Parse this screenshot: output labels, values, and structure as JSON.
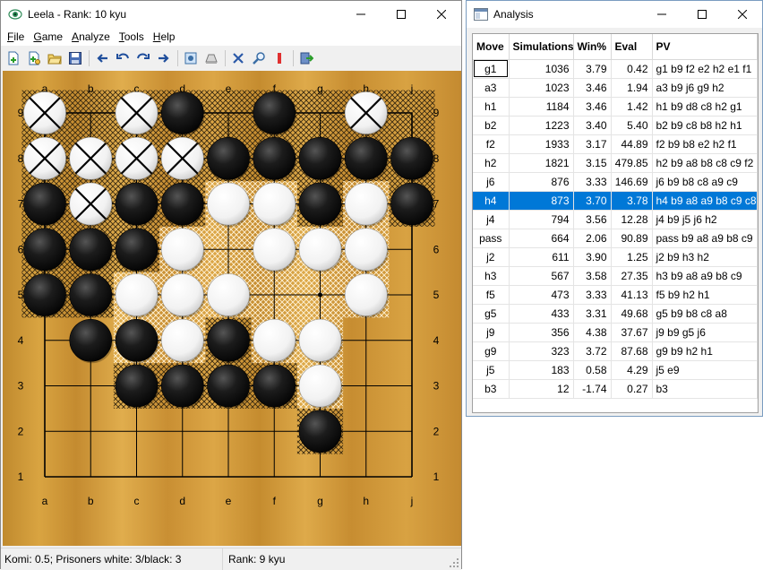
{
  "leela": {
    "title": "Leela - Rank: 10 kyu",
    "menu": [
      {
        "label": "File",
        "key": "F"
      },
      {
        "label": "Game",
        "key": "G"
      },
      {
        "label": "Analyze",
        "key": "A"
      },
      {
        "label": "Tools",
        "key": "T"
      },
      {
        "label": "Help",
        "key": "H"
      }
    ],
    "toolbar_icons": [
      "new-game-icon",
      "new-game-settings-icon",
      "open-file-icon",
      "save-file-icon",
      "back-icon",
      "undo-icon",
      "redo-icon",
      "forward-icon",
      "settings-icon",
      "score-icon",
      "resign-icon",
      "analyze-icon",
      "flag-icon",
      "exit-icon"
    ],
    "status": {
      "left": "Komi: 0.5; Prisoners white: 3/black: 3",
      "right": "Rank: 9 kyu"
    },
    "board": {
      "columns": [
        "a",
        "b",
        "c",
        "d",
        "e",
        "f",
        "g",
        "h",
        "j"
      ],
      "rows": [
        "9",
        "8",
        "7",
        "6",
        "5",
        "4",
        "3",
        "2",
        "1"
      ],
      "stones": [
        {
          "c": 0,
          "r": 9,
          "color": "white",
          "dead": true
        },
        {
          "c": 2,
          "r": 9,
          "color": "white",
          "dead": true
        },
        {
          "c": 3,
          "r": 9,
          "color": "black"
        },
        {
          "c": 5,
          "r": 9,
          "color": "black"
        },
        {
          "c": 7,
          "r": 9,
          "color": "white",
          "dead": true
        },
        {
          "c": 0,
          "r": 8,
          "color": "white",
          "dead": true
        },
        {
          "c": 1,
          "r": 8,
          "color": "white",
          "dead": true
        },
        {
          "c": 2,
          "r": 8,
          "color": "white",
          "dead": true
        },
        {
          "c": 3,
          "r": 8,
          "color": "white",
          "dead": true
        },
        {
          "c": 4,
          "r": 8,
          "color": "black"
        },
        {
          "c": 5,
          "r": 8,
          "color": "black"
        },
        {
          "c": 6,
          "r": 8,
          "color": "black"
        },
        {
          "c": 7,
          "r": 8,
          "color": "black"
        },
        {
          "c": 8,
          "r": 8,
          "color": "black"
        },
        {
          "c": 0,
          "r": 7,
          "color": "black"
        },
        {
          "c": 1,
          "r": 7,
          "color": "white",
          "dead": true
        },
        {
          "c": 2,
          "r": 7,
          "color": "black"
        },
        {
          "c": 3,
          "r": 7,
          "color": "black"
        },
        {
          "c": 4,
          "r": 7,
          "color": "white"
        },
        {
          "c": 5,
          "r": 7,
          "color": "white"
        },
        {
          "c": 6,
          "r": 7,
          "color": "black"
        },
        {
          "c": 7,
          "r": 7,
          "color": "white"
        },
        {
          "c": 8,
          "r": 7,
          "color": "black"
        },
        {
          "c": 0,
          "r": 6,
          "color": "black"
        },
        {
          "c": 1,
          "r": 6,
          "color": "black"
        },
        {
          "c": 2,
          "r": 6,
          "color": "black"
        },
        {
          "c": 3,
          "r": 6,
          "color": "white"
        },
        {
          "c": 5,
          "r": 6,
          "color": "white"
        },
        {
          "c": 6,
          "r": 6,
          "color": "white"
        },
        {
          "c": 7,
          "r": 6,
          "color": "white"
        },
        {
          "c": 0,
          "r": 5,
          "color": "black"
        },
        {
          "c": 1,
          "r": 5,
          "color": "black"
        },
        {
          "c": 2,
          "r": 5,
          "color": "white"
        },
        {
          "c": 3,
          "r": 5,
          "color": "white"
        },
        {
          "c": 4,
          "r": 5,
          "color": "white"
        },
        {
          "c": 7,
          "r": 5,
          "color": "white"
        },
        {
          "c": 1,
          "r": 4,
          "color": "black"
        },
        {
          "c": 2,
          "r": 4,
          "color": "black"
        },
        {
          "c": 3,
          "r": 4,
          "color": "white"
        },
        {
          "c": 4,
          "r": 4,
          "color": "black"
        },
        {
          "c": 5,
          "r": 4,
          "color": "white"
        },
        {
          "c": 6,
          "r": 4,
          "color": "white"
        },
        {
          "c": 2,
          "r": 3,
          "color": "black"
        },
        {
          "c": 3,
          "r": 3,
          "color": "black"
        },
        {
          "c": 4,
          "r": 3,
          "color": "black"
        },
        {
          "c": 5,
          "r": 3,
          "color": "black"
        },
        {
          "c": 6,
          "r": 3,
          "color": "white"
        },
        {
          "c": 6,
          "r": 2,
          "color": "black"
        }
      ],
      "black_territory": [
        [
          0,
          9
        ],
        [
          1,
          9
        ],
        [
          2,
          9
        ],
        [
          3,
          9
        ],
        [
          4,
          9
        ],
        [
          5,
          9
        ],
        [
          6,
          9
        ],
        [
          7,
          9
        ],
        [
          8,
          9
        ],
        [
          0,
          8
        ],
        [
          1,
          8
        ],
        [
          2,
          8
        ],
        [
          3,
          8
        ],
        [
          4,
          8
        ],
        [
          5,
          8
        ],
        [
          6,
          8
        ],
        [
          7,
          8
        ],
        [
          8,
          8
        ],
        [
          0,
          7
        ],
        [
          1,
          7
        ],
        [
          2,
          7
        ],
        [
          3,
          7
        ],
        [
          6,
          7
        ],
        [
          8,
          7
        ],
        [
          0,
          6
        ],
        [
          1,
          6
        ],
        [
          2,
          6
        ],
        [
          0,
          5
        ],
        [
          1,
          5
        ],
        [
          4,
          4
        ],
        [
          2,
          3
        ],
        [
          3,
          3
        ],
        [
          4,
          3
        ],
        [
          5,
          3
        ],
        [
          6,
          2
        ]
      ],
      "white_territory": [
        [
          4,
          7
        ],
        [
          5,
          7
        ],
        [
          7,
          7
        ],
        [
          3,
          6
        ],
        [
          4,
          6
        ],
        [
          5,
          6
        ],
        [
          6,
          6
        ],
        [
          7,
          6
        ],
        [
          2,
          5
        ],
        [
          3,
          5
        ],
        [
          4,
          5
        ],
        [
          5,
          5
        ],
        [
          6,
          5
        ],
        [
          7,
          5
        ],
        [
          2,
          4
        ],
        [
          3,
          4
        ],
        [
          5,
          4
        ],
        [
          6,
          4
        ],
        [
          6,
          3
        ]
      ]
    }
  },
  "analysis": {
    "title": "Analysis",
    "headers": [
      "Move",
      "Simulations",
      "Win%",
      "Eval",
      "PV"
    ],
    "rows": [
      [
        "g1",
        "1036",
        "3.79",
        "0.42",
        "g1 b9 f2 e2 h2 e1 f1"
      ],
      [
        "a3",
        "1023",
        "3.46",
        "1.94",
        "a3 b9 j6 g9 h2"
      ],
      [
        "h1",
        "1184",
        "3.46",
        "1.42",
        "h1 b9 d8 c8 h2 g1"
      ],
      [
        "b2",
        "1223",
        "3.40",
        "5.40",
        "b2 b9 c8 b8 h2 h1"
      ],
      [
        "f2",
        "1933",
        "3.17",
        "44.89",
        "f2 b9 b8 e2 h2 f1"
      ],
      [
        "h2",
        "1821",
        "3.15",
        "479.85",
        "h2 b9 a8 b8 c8 c9 f2"
      ],
      [
        "j6",
        "876",
        "3.33",
        "146.69",
        "j6 b9 b8 c8 a9 c9"
      ],
      [
        "h4",
        "873",
        "3.70",
        "3.78",
        "h4 b9 a8 a9 b8 c9 c8"
      ],
      [
        "j4",
        "794",
        "3.56",
        "12.28",
        "j4 b9 j5 j6 h2"
      ],
      [
        "pass",
        "664",
        "2.06",
        "90.89",
        "pass b9 a8 a9 b8 c9"
      ],
      [
        "j2",
        "611",
        "3.90",
        "1.25",
        "j2 b9 h3 h2"
      ],
      [
        "h3",
        "567",
        "3.58",
        "27.35",
        "h3 b9 a8 a9 b8 c9"
      ],
      [
        "f5",
        "473",
        "3.33",
        "41.13",
        "f5 b9 h2 h1"
      ],
      [
        "g5",
        "433",
        "3.31",
        "49.68",
        "g5 b9 b8 c8 a8"
      ],
      [
        "j9",
        "356",
        "4.38",
        "37.67",
        "j9 b9 g5 j6"
      ],
      [
        "g9",
        "323",
        "3.72",
        "87.68",
        "g9 b9 h2 h1"
      ],
      [
        "j5",
        "183",
        "0.58",
        "4.29",
        "j5 e9"
      ],
      [
        "b3",
        "12",
        "-1.74",
        "0.27",
        "b3"
      ]
    ],
    "selected_row": 7,
    "focused_row": 0
  },
  "colors": {
    "selection": "#0078d7",
    "board_line": "#000000"
  }
}
